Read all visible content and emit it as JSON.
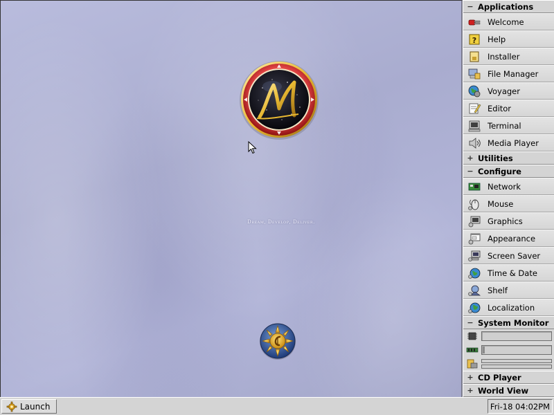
{
  "desktop": {
    "tagline": "Dream, Develop, Deliver."
  },
  "shelf": {
    "applications": {
      "toggle": "−",
      "title": "Applications",
      "items": [
        {
          "label": "Welcome",
          "icon": "welcome-icon"
        },
        {
          "label": "Help",
          "icon": "help-icon"
        },
        {
          "label": "Installer",
          "icon": "installer-icon"
        },
        {
          "label": "File Manager",
          "icon": "file-manager-icon"
        },
        {
          "label": "Voyager",
          "icon": "voyager-icon"
        },
        {
          "label": "Editor",
          "icon": "editor-icon"
        },
        {
          "label": "Terminal",
          "icon": "terminal-icon"
        },
        {
          "label": "Media Player",
          "icon": "media-player-icon"
        }
      ]
    },
    "utilities": {
      "toggle": "+",
      "title": "Utilities"
    },
    "configure": {
      "toggle": "−",
      "title": "Configure",
      "items": [
        {
          "label": "Network",
          "icon": "network-icon"
        },
        {
          "label": "Mouse",
          "icon": "mouse-icon"
        },
        {
          "label": "Graphics",
          "icon": "graphics-icon"
        },
        {
          "label": "Appearance",
          "icon": "appearance-icon"
        },
        {
          "label": "Screen Saver",
          "icon": "screen-saver-icon"
        },
        {
          "label": "Time & Date",
          "icon": "time-date-icon"
        },
        {
          "label": "Shelf",
          "icon": "shelf-icon"
        },
        {
          "label": "Localization",
          "icon": "localization-icon"
        }
      ]
    },
    "system_monitor": {
      "toggle": "−",
      "title": "System Monitor",
      "cpu_load": 0.0,
      "memory_load": 0.03,
      "icons": [
        "cpu-icon",
        "memory-icon",
        "disk-icon"
      ]
    },
    "cd_player": {
      "toggle": "+",
      "title": "CD Player"
    },
    "world_view": {
      "toggle": "+",
      "title": "World View"
    }
  },
  "taskbar": {
    "launch_label": "Launch",
    "clock": "Fri-18 04:02PM"
  },
  "colors": {
    "desktop_base": "#b2b5d8",
    "logo_ring": "#c82828",
    "logo_gold": "#e8b832",
    "panel_bg": "#d8d8d8"
  }
}
